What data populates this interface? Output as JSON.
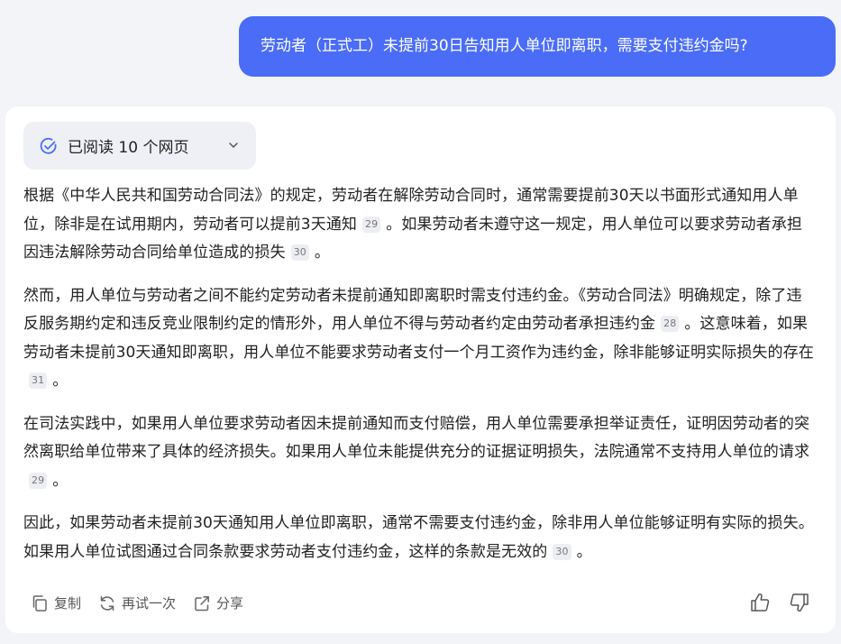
{
  "user_message": "劳动者（正式工）未提前30日告知用人单位即离职，需要支付违约金吗?",
  "sources": {
    "label": "已阅读 10 个网页"
  },
  "answer": {
    "paragraphs": [
      {
        "segments": [
          {
            "type": "text",
            "value": "根据《中华人民共和国劳动合同法》的规定，劳动者在解除劳动合同时，通常需要提前30天以书面形式通知用人单位，除非是在试用期内，劳动者可以提前3天通知"
          },
          {
            "type": "cite",
            "value": "29"
          },
          {
            "type": "text",
            "value": "。如果劳动者未遵守这一规定，用人单位可以要求劳动者承担因违法解除劳动合同给单位造成的损失"
          },
          {
            "type": "cite",
            "value": "30"
          },
          {
            "type": "text",
            "value": "。"
          }
        ]
      },
      {
        "segments": [
          {
            "type": "text",
            "value": "然而，用人单位与劳动者之间不能约定劳动者未提前通知即离职时需支付违约金。《劳动合同法》明确规定，除了违反服务期约定和违反竞业限制约定的情形外，用人单位不得与劳动者约定由劳动者承担违约金"
          },
          {
            "type": "cite",
            "value": "28"
          },
          {
            "type": "text",
            "value": "。这意味着，如果劳动者未提前30天通知即离职，用人单位不能要求劳动者支付一个月工资作为违约金，除非能够证明实际损失的存在"
          },
          {
            "type": "cite",
            "value": "31"
          },
          {
            "type": "text",
            "value": "。"
          }
        ]
      },
      {
        "segments": [
          {
            "type": "text",
            "value": "在司法实践中，如果用人单位要求劳动者因未提前通知而支付赔偿，用人单位需要承担举证责任，证明因劳动者的突然离职给单位带来了具体的经济损失。如果用人单位未能提供充分的证据证明损失，法院通常不支持用人单位的请求"
          },
          {
            "type": "cite",
            "value": "29"
          },
          {
            "type": "text",
            "value": "。"
          }
        ]
      },
      {
        "segments": [
          {
            "type": "text",
            "value": "因此，如果劳动者未提前30天通知用人单位即离职，通常不需要支付违约金，除非用人单位能够证明有实际的损失。如果用人单位试图通过合同条款要求劳动者支付违约金，这样的条款是无效的"
          },
          {
            "type": "cite",
            "value": "30"
          },
          {
            "type": "text",
            "value": "。"
          }
        ]
      }
    ]
  },
  "actions": {
    "copy": "复制",
    "retry": "再试一次",
    "share": "分享"
  },
  "icons": {
    "check": "check-circle-icon",
    "chevron": "chevron-down-icon",
    "copy": "copy-icon",
    "retry": "refresh-icon",
    "share": "share-icon",
    "like": "thumbs-up-icon",
    "dislike": "thumbs-down-icon"
  },
  "colors": {
    "user_bubble": "#4a6cf7",
    "accent_icon": "#4a6cf7",
    "background": "#f3f4f8"
  }
}
